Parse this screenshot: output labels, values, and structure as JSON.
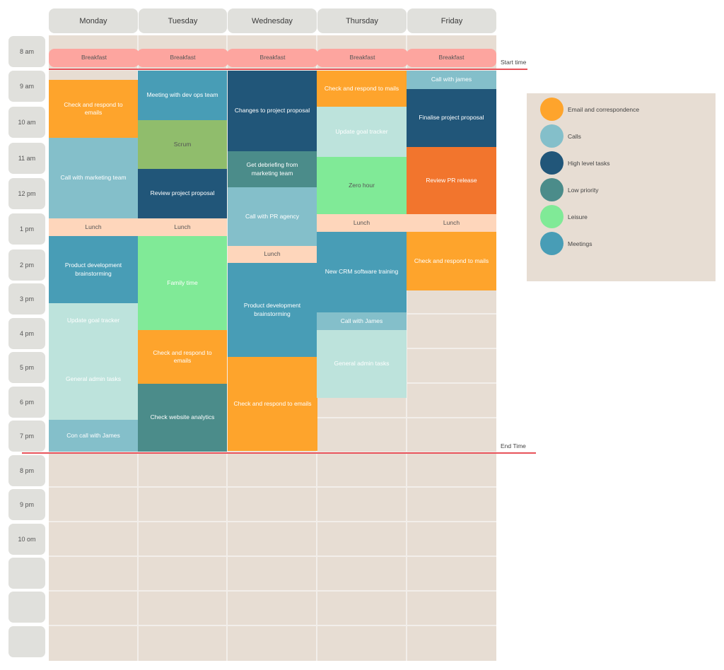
{
  "days": [
    "Monday",
    "Tuesday",
    "Wednesday",
    "Thursday",
    "Friday"
  ],
  "times": [
    "8 am",
    "9 am",
    "10 am",
    "11 am",
    "12 pm",
    "1 pm",
    "2 pm",
    "3 pm",
    "4 pm",
    "5 pm",
    "6 pm",
    "7 pm",
    "8 pm",
    "9 pm",
    "10 om",
    "",
    "",
    ""
  ],
  "markers": {
    "start_label": "Start time",
    "end_label": "End Time"
  },
  "colors": {
    "email": "#fea42c",
    "calls": "#84bfca",
    "high": "#215679",
    "low": "#4b8c8a",
    "leisure": "#80ea97",
    "meetings": "#489db6",
    "breakfast": "#fda59f",
    "lunch": "#fed6bb",
    "scrum": "#90bd6c",
    "goal": "#bde3dc",
    "pr": "#f2752d"
  },
  "legend": [
    {
      "label": "Email and correspondence",
      "color": "#fea42c"
    },
    {
      "label": "Calls",
      "color": "#84bfca"
    },
    {
      "label": "High level tasks",
      "color": "#215679"
    },
    {
      "label": "Low priority",
      "color": "#4b8c8a"
    },
    {
      "label": "Leisure",
      "color": "#80ea97"
    },
    {
      "label": "Meetings",
      "color": "#489db6"
    }
  ],
  "events": {
    "monday": [
      {
        "label": "Breakfast",
        "category": "breakfast"
      },
      {
        "label": "Check and respond to emails",
        "category": "email"
      },
      {
        "label": "Call with marketing team",
        "category": "calls"
      },
      {
        "label": "Lunch",
        "category": "lunch"
      },
      {
        "label": "Product development brainstorming",
        "category": "meetings"
      },
      {
        "label": "Update goal tracker",
        "category": "goal"
      },
      {
        "label": "General admin tasks",
        "category": "goal"
      },
      {
        "label": "Con call with James",
        "category": "calls"
      }
    ],
    "tuesday": [
      {
        "label": "Breakfast",
        "category": "breakfast"
      },
      {
        "label": "Meeting with dev ops team",
        "category": "meetings"
      },
      {
        "label": "Scrum",
        "category": "scrum"
      },
      {
        "label": "Review project proposal",
        "category": "high"
      },
      {
        "label": "Lunch",
        "category": "lunch"
      },
      {
        "label": "Family time",
        "category": "leisure"
      },
      {
        "label": "Check and respond to emails",
        "category": "email"
      },
      {
        "label": "Check website analytics",
        "category": "low"
      }
    ],
    "wednesday": [
      {
        "label": "Breakfast",
        "category": "breakfast"
      },
      {
        "label": "Changes to project proposal",
        "category": "high"
      },
      {
        "label": "Get debriefing from marketing team",
        "category": "low"
      },
      {
        "label": "Call with PR agency",
        "category": "calls"
      },
      {
        "label": "Lunch",
        "category": "lunch"
      },
      {
        "label": "Product development brainstorming",
        "category": "meetings"
      },
      {
        "label": "Check and respond to emails",
        "category": "email"
      }
    ],
    "thursday": [
      {
        "label": "Breakfast",
        "category": "breakfast"
      },
      {
        "label": "Check and respond to mails",
        "category": "email"
      },
      {
        "label": "Update goal tracker",
        "category": "goal"
      },
      {
        "label": "Zero hour",
        "category": "leisure"
      },
      {
        "label": "Lunch",
        "category": "lunch"
      },
      {
        "label": "New CRM software training",
        "category": "meetings"
      },
      {
        "label": "Call with James",
        "category": "calls"
      },
      {
        "label": "General admin tasks",
        "category": "goal"
      }
    ],
    "friday": [
      {
        "label": "Breakfast",
        "category": "breakfast"
      },
      {
        "label": "Call with james",
        "category": "calls"
      },
      {
        "label": "Finalise  project proposal",
        "category": "high"
      },
      {
        "label": "Review PR release",
        "category": "pr"
      },
      {
        "label": "Lunch",
        "category": "lunch"
      },
      {
        "label": "Check and respond to mails",
        "category": "email"
      }
    ]
  }
}
